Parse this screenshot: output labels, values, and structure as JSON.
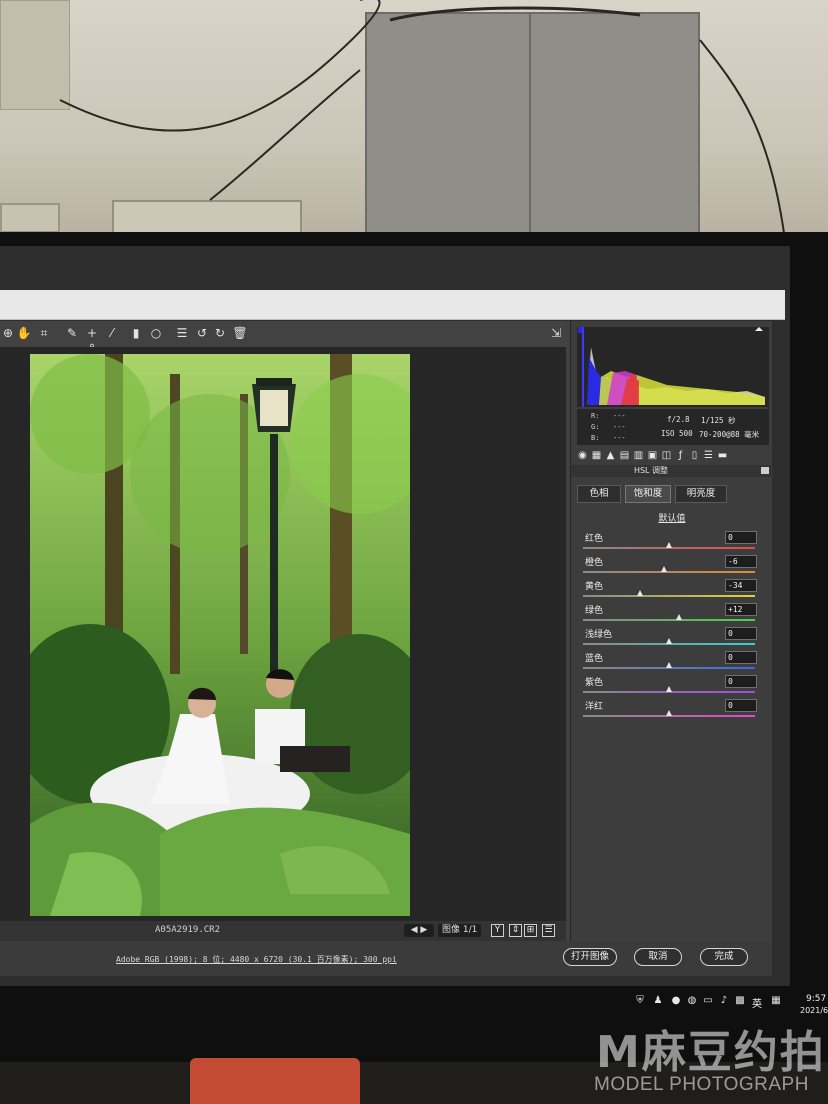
{
  "toolbar": {
    "tools": [
      "zoom-tool",
      "hand-tool",
      "white-balance-tool",
      "crop-tool",
      "straighten-tool",
      "spot-removal-tool",
      "red-eye-tool",
      "brush-tool",
      "graduated-filter-tool",
      "radial-filter-tool",
      "preferences-tool",
      "rotate-left-tool",
      "rotate-right-tool",
      "trash-tool"
    ],
    "open_tool": "toggle-fullscreen-icon"
  },
  "histogram": {
    "r_label": "R:",
    "g_label": "G:",
    "b_label": "B:",
    "r_value": "---",
    "g_value": "---",
    "b_value": "---",
    "aperture": "f/2.8",
    "shutter": "1/125 秒",
    "iso": "ISO 500",
    "lens": "70-200@88 毫米"
  },
  "panel": {
    "section_title": "HSL 调整",
    "subtabs": [
      "色相",
      "饱和度",
      "明亮度"
    ],
    "active_subtab": 1,
    "default_link": "默认值",
    "sliders": [
      {
        "label": "红色",
        "value": "0",
        "position": 0.5,
        "track": "linear-gradient(90deg,#8a8a8a,#e24a4a)"
      },
      {
        "label": "橙色",
        "value": "-6",
        "position": 0.47,
        "track": "linear-gradient(90deg,#8a8a8a,#e08a3a)"
      },
      {
        "label": "黄色",
        "value": "-34",
        "position": 0.33,
        "track": "linear-gradient(90deg,#8a8a8a,#e0d23a)"
      },
      {
        "label": "绿色",
        "value": "+12",
        "position": 0.56,
        "track": "linear-gradient(90deg,#8a8a8a,#4ad04a)"
      },
      {
        "label": "浅绿色",
        "value": "0",
        "position": 0.5,
        "track": "linear-gradient(90deg,#8a8a8a,#3ad0c8)"
      },
      {
        "label": "蓝色",
        "value": "0",
        "position": 0.5,
        "track": "linear-gradient(90deg,#8a8a8a,#3a6ae0)"
      },
      {
        "label": "紫色",
        "value": "0",
        "position": 0.5,
        "track": "linear-gradient(90deg,#8a8a8a,#a44ae0)"
      },
      {
        "label": "洋红",
        "value": "0",
        "position": 0.5,
        "track": "linear-gradient(90deg,#8a8a8a,#e04ac8)"
      }
    ]
  },
  "filmstrip": {
    "filename": "A05A2919.CR2",
    "nav": "◀ ▶",
    "image_counter": "图像 1/1",
    "view_buttons": [
      "Y",
      "⇕",
      "⊞",
      "☰"
    ]
  },
  "footer": {
    "workflow": "Adobe RGB (1998); 8 位; 4480 x 6720 (30.1 百万像素); 300 ppi",
    "open_image": "打开图像",
    "cancel": "取消",
    "done": "完成"
  },
  "taskbar": {
    "language": "英",
    "time": "9:57",
    "date": "2021/6"
  },
  "watermark": {
    "logo": "M麻豆约拍",
    "subtitle": "MODEL PHOTOGRAPH"
  },
  "colors": {
    "panel_bg": "#3d3d3d",
    "dialog_bg": "#414141",
    "canvas_bg": "#262626",
    "photo_green": "#3c6b2a"
  }
}
